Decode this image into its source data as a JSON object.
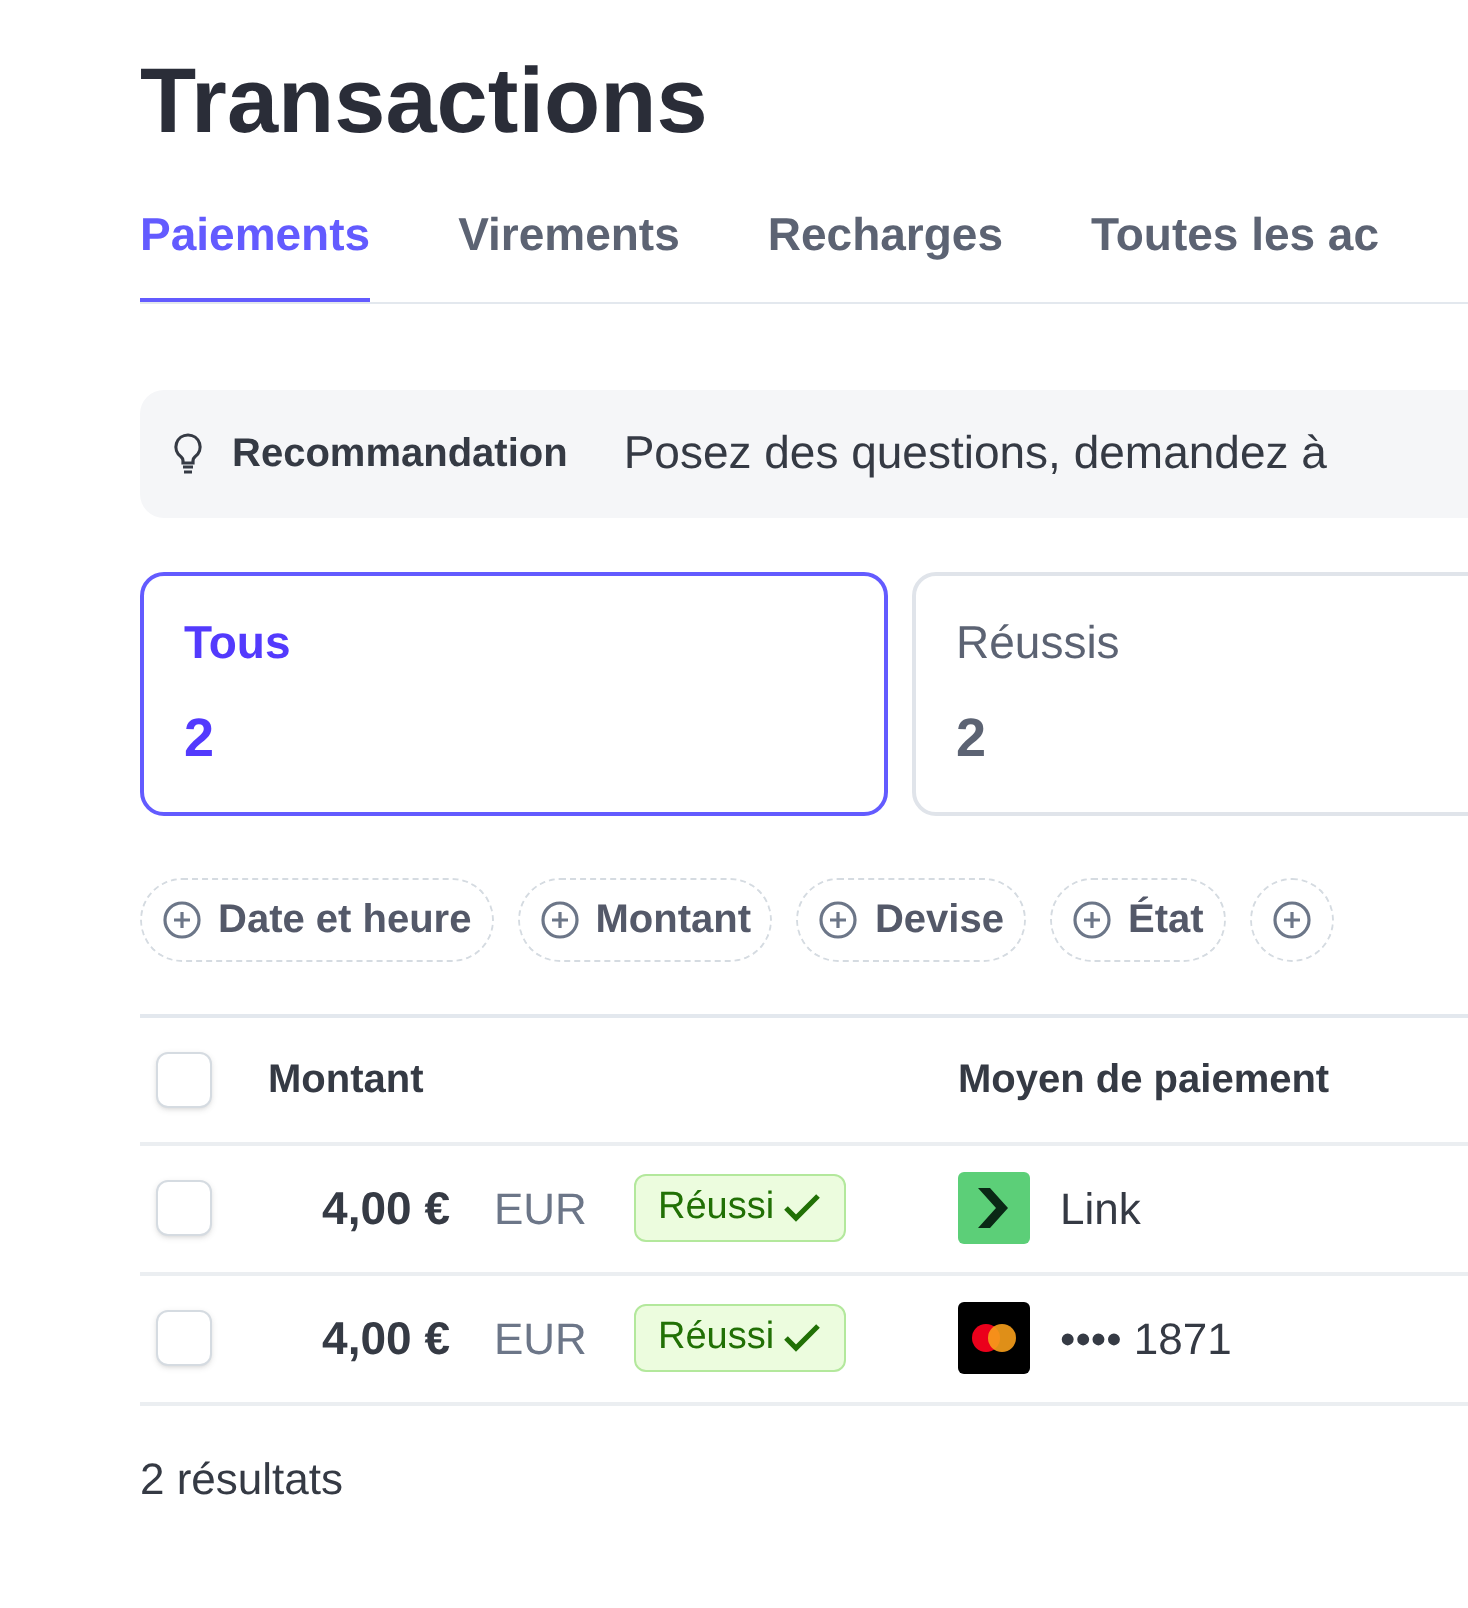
{
  "title": "Transactions",
  "tabs": [
    {
      "label": "Paiements",
      "selected": true
    },
    {
      "label": "Virements",
      "selected": false
    },
    {
      "label": "Recharges",
      "selected": false
    },
    {
      "label": "Toutes les ac",
      "selected": false
    }
  ],
  "recommendation": {
    "label": "Recommandation",
    "text": "Posez des questions, demandez à"
  },
  "summary_cards": [
    {
      "label": "Tous",
      "count": "2",
      "selected": true
    },
    {
      "label": "Réussis",
      "count": "2",
      "selected": false
    }
  ],
  "filters": [
    {
      "kind": "labeled",
      "label": "Date et heure"
    },
    {
      "kind": "labeled",
      "label": "Montant"
    },
    {
      "kind": "labeled",
      "label": "Devise"
    },
    {
      "kind": "labeled",
      "label": "État"
    },
    {
      "kind": "icon_only"
    }
  ],
  "table": {
    "columns": [
      "Montant",
      "Moyen de paiement"
    ],
    "header_checked": false,
    "rows": [
      {
        "checked": false,
        "amount": "4,00 €",
        "currency": "EUR",
        "status": "Réussi",
        "kind": "link",
        "method": "Link"
      },
      {
        "checked": false,
        "amount": "4,00 €",
        "currency": "EUR",
        "status": "Réussi",
        "kind": "card",
        "method": "•••• 1871"
      }
    ]
  },
  "results": "2 résultats"
}
